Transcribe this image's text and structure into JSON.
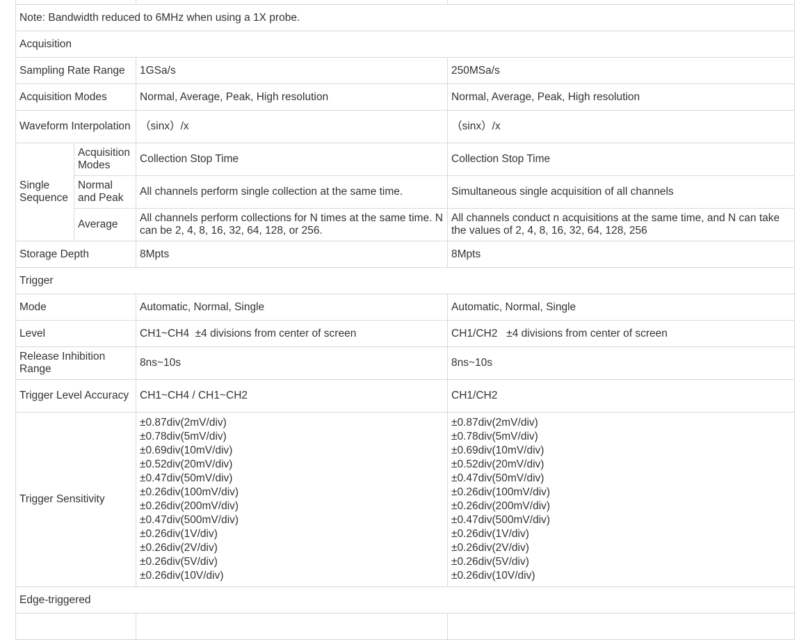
{
  "note": "Note: Bandwidth reduced to 6MHz when using a 1X probe.",
  "sections": {
    "acquisition": "Acquisition",
    "trigger": "Trigger",
    "edge": "Edge-triggered"
  },
  "acquisition_rows": {
    "sampling": {
      "label": "Sampling Rate Range",
      "col1": "1GSa/s",
      "col2": "250MSa/s"
    },
    "modes": {
      "label": "Acquisition Modes",
      "col1": "Normal, Average, Peak, High resolution",
      "col2": "Normal, Average, Peak, High resolution"
    },
    "interp": {
      "label": "Waveform Interpolation",
      "col1": "（sinx）/x",
      "col2": "（sinx）/x"
    },
    "single_sequence": {
      "label": "Single Sequence",
      "sub": [
        {
          "label": "Acquisition Modes",
          "col1": "Collection Stop Time",
          "col2": "Collection Stop Time"
        },
        {
          "label": "Normal and Peak",
          "col1": "All channels perform single collection at the same time.",
          "col2": "Simultaneous single acquisition of all channels"
        },
        {
          "label": "Average",
          "col1": "All channels perform collections for N times at the same time. N can be 2, 4, 8, 16, 32, 64, 128, or 256.",
          "col2": "All channels conduct n acquisitions at the same time, and N can take the values of 2, 4, 8, 16, 32, 64, 128, 256"
        }
      ]
    },
    "storage": {
      "label": "Storage Depth",
      "col1": "8Mpts",
      "col2": "8Mpts"
    }
  },
  "trigger_rows": {
    "mode": {
      "label": "Mode",
      "col1": "Automatic, Normal, Single",
      "col2": "Automatic, Normal, Single"
    },
    "level": {
      "label": "Level",
      "col1": "CH1~CH4  ±4 divisions from center of screen",
      "col2": "CH1/CH2   ±4 divisions from center of screen"
    },
    "release": {
      "label": "Release Inhibition Range",
      "col1": "8ns~10s",
      "col2": "8ns~10s"
    },
    "accuracy": {
      "label": "Trigger Level Accuracy",
      "col1": "CH1~CH4 / CH1~CH2",
      "col2": "CH1/CH2"
    },
    "sensitivity": {
      "label": "Trigger Sensitivity",
      "col1": [
        "±0.87div(2mV/div)",
        "±0.78div(5mV/div)",
        "±0.69div(10mV/div)",
        "±0.52div(20mV/div)",
        "±0.47div(50mV/div)",
        "±0.26div(100mV/div)",
        "±0.26div(200mV/div)",
        "±0.47div(500mV/div)",
        "±0.26div(1V/div)",
        "±0.26div(2V/div)",
        "±0.26div(5V/div)",
        "±0.26div(10V/div)"
      ],
      "col2": [
        "±0.87div(2mV/div)",
        "±0.78div(5mV/div)",
        "±0.69div(10mV/div)",
        "±0.52div(20mV/div)",
        "±0.47div(50mV/div)",
        "±0.26div(100mV/div)",
        "±0.26div(200mV/div)",
        "±0.47div(500mV/div)",
        "±0.26div(1V/div)",
        "±0.26div(2V/div)",
        "±0.26div(5V/div)",
        "±0.26div(10V/div)"
      ]
    }
  },
  "colors": {
    "text": "#333333",
    "border": "#d9d9d9",
    "background": "#ffffff"
  }
}
